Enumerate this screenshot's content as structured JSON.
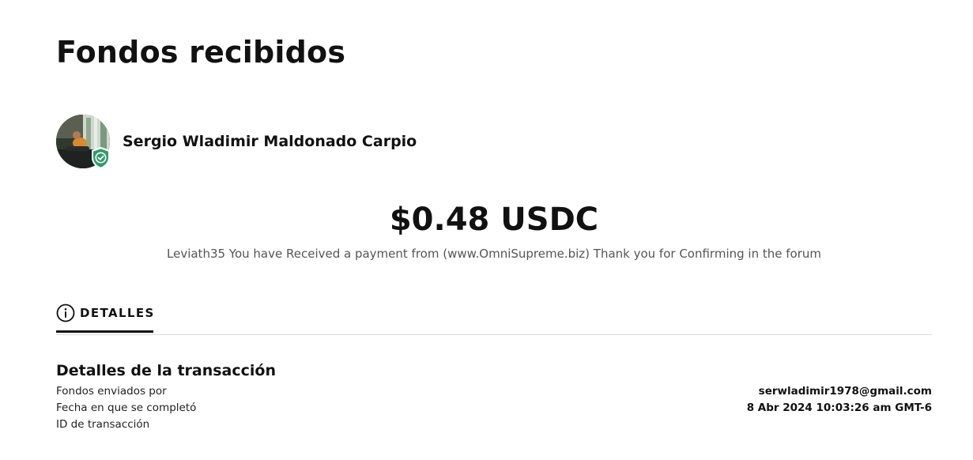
{
  "page": {
    "title": "Fondos recibidos"
  },
  "sender": {
    "name": "Sergio Wladimir Maldonado Carpio",
    "avatar_icon": "profile-photo",
    "badge_icon": "verified-shield-check-icon",
    "badge_color": "#2e9c6a"
  },
  "payment": {
    "amount": "$0.48 USDC",
    "memo": "Leviath35 You have Received a payment from (www.OmniSupreme.biz) Thank you for Confirming in the forum"
  },
  "tabs": {
    "details_label": "DETALLES",
    "details_icon": "info-circle-icon"
  },
  "transaction": {
    "section_title": "Detalles de la transacción",
    "rows": [
      {
        "label": "Fondos enviados por",
        "value": "serwladimir1978@gmail.com"
      },
      {
        "label": "Fecha en que se completó",
        "value": "8 Abr 2024 10:03:26 am GMT-6"
      },
      {
        "label": "ID de transacción",
        "value": ""
      }
    ]
  }
}
